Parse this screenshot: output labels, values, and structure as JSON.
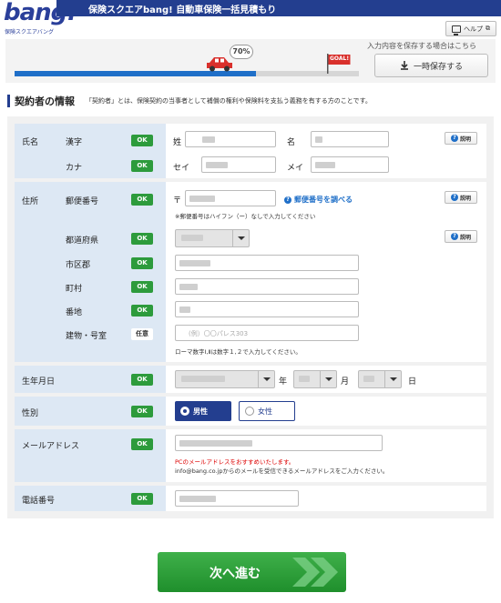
{
  "header": {
    "logo_text": "bang!",
    "logo_sub": "保険スクエアバング",
    "title": "保険スクエアbang! 自動車保険一括見積もり",
    "help_label": "ヘルプ"
  },
  "progress": {
    "percent_label": "70%",
    "percent": 70,
    "goal_label": "GOAL!",
    "save_hint": "入力内容を保存する場合はこちら",
    "save_button": "一時保存する"
  },
  "section": {
    "title": "契約者の情報",
    "description": "「契約者」とは、保険契約の当事者として補償の権利や保険料を支払う義務を有する方のことです。"
  },
  "labels": {
    "name": "氏名",
    "kanji": "漢字",
    "kana": "カナ",
    "sei_kanji": "姓",
    "mei_kanji": "名",
    "sei_kana": "セイ",
    "mei_kana": "メイ",
    "address": "住所",
    "postal": "郵便番号",
    "postal_mark": "〒",
    "postal_lookup": "郵便番号を調べる",
    "postal_note": "※郵便番号はハイフン（ー）なしで入力してください",
    "prefecture": "都道府県",
    "city": "市区郡",
    "town": "町村",
    "banchi": "番地",
    "building": "建物・号室",
    "building_placeholder": "(例）〇〇パレス303",
    "building_note": "ローマ数字Ⅰ,Ⅱは数字１,２で入力してください。",
    "birth": "生年月日",
    "year": "年",
    "month": "月",
    "day": "日",
    "gender": "性別",
    "male": "男性",
    "female": "女性",
    "email": "メールアドレス",
    "email_note1": "PCのメールアドレスをおすすめいたします。",
    "email_note2": "info@bang.co.jpからのメールを受信できるメールアドレスをご入力ください。",
    "phone": "電話番号",
    "ok": "OK",
    "optional": "任意",
    "explain": "説明"
  },
  "next_button": "次へ進む",
  "colors": {
    "brand": "#233e8f",
    "ok_green": "#2d9b3c",
    "label_bg": "#dde8f4",
    "progress": "#1f6fc8"
  }
}
